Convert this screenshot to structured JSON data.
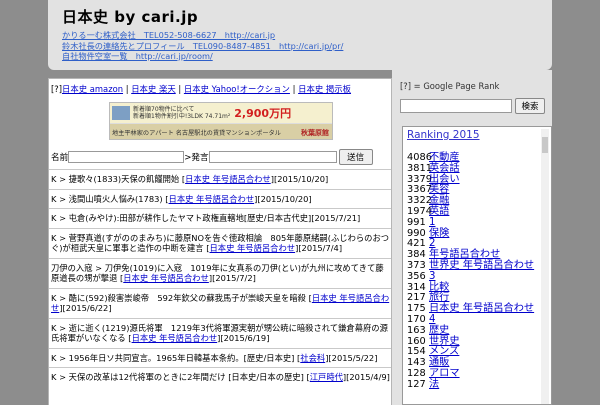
{
  "header": {
    "title": "日本史 by cari.jp",
    "links": [
      "かりる一む株式会社　TEL052-508-6627　http://cari.jp",
      "鈴木社長の連絡先とプロフィール　TEL090-8487-4851　http://cari.jp/pr/",
      "自社物件空室一覧　http://cari.jp/room/"
    ]
  },
  "main": {
    "toplinks": [
      "[?]",
      "日本史 amazon",
      "日本史 楽天",
      "日本史 Yahoo!オークション",
      "日本史 掲示板"
    ],
    "banner": {
      "line1": "新着順70物件に比べて",
      "line1b": "新着順1物件割引中!3LDK 74.71m²",
      "price": "2,900万円",
      "bottom_left": "地主平林家のアパート",
      "bottom_mid": "名古屋駅北の賃貸マンションポータル",
      "bottom_right": "秋葉原館"
    },
    "form": {
      "name_label": "名前",
      "speech_label": ">発言",
      "submit": "送信"
    },
    "entries": [
      {
        "text": "K > 捷歌々(1833)天保の飢饉開始 [",
        "link": "日本史 年号語呂合わせ",
        "tail": "][2015/10/20]"
      },
      {
        "text": "K > 浅間山噴火人悩み(1783) [",
        "link": "日本史 年号語呂合わせ",
        "tail": "][2015/10/20]"
      },
      {
        "text": "K > 屯倉(みやけ):田部が耕作したヤマト政権直轄地[歴史/日本古代史][2015/7/21]",
        "link": "",
        "tail": ""
      },
      {
        "text": "K > 菅野真道(すがののまみち)に藤原NOを告ぐ徳政相論　805年藤原緒嗣(ふじわらのおつぐ)が桓武天皇に軍事と造作の中断を建言 [",
        "link": "日本史 年号語呂合わせ",
        "tail": "][2015/7/4]"
      },
      {
        "text": "刀伊の入寇 > 刀伊免(1019)に入寇　1019年に女真系の刀伊(とい)が九州に攻めてきて藤原道長の甥が撃退 [",
        "link": "日本史 年号語呂合わせ",
        "tail": "][2015/7/2]"
      },
      {
        "text": "K > 酷に(592)殺害崇峻帝　592年欽父の蘇我馬子が崇峻天皇を暗殺 [",
        "link": "日本史 年号語呂合わせ",
        "tail": "][2015/6/22]"
      },
      {
        "text": "K > 逝に逝く(1219)源氏将軍　1219年3代将軍源実朝が甥公暁に暗殺されて鎌倉幕府の源氏将軍がいなくなる [",
        "link": "日本史 年号語呂合わせ",
        "tail": "][2015/6/19]"
      },
      {
        "text": "K > 1956年日ソ共同宣言。1965年日韓基本条約。[歴史/日本史] [",
        "link": "社会科",
        "tail": "][2015/5/22]"
      },
      {
        "text": "K > 天保の改革は12代将軍のときに2年間だけ [日本史/日本の歴史] [",
        "link": "江戸時代",
        "tail": "][2015/4/9]"
      }
    ]
  },
  "sidebar": {
    "gpr": "[?] = Google Page Rank",
    "search_button": "検索",
    "ranking_title": "Ranking 2015",
    "ranking": [
      {
        "n": "4086",
        "label": "不動産"
      },
      {
        "n": "3811",
        "label": "英会話"
      },
      {
        "n": "3379",
        "label": "出会い"
      },
      {
        "n": "3367",
        "label": "美容"
      },
      {
        "n": "3322",
        "label": "金融"
      },
      {
        "n": "1974",
        "label": "英語"
      },
      {
        "n": "991",
        "label": "1"
      },
      {
        "n": "990",
        "label": "保険"
      },
      {
        "n": "421",
        "label": "2"
      },
      {
        "n": "384",
        "label": "年号語呂合わせ"
      },
      {
        "n": "373",
        "label": "世界史 年号語呂合わせ"
      },
      {
        "n": "356",
        "label": "3"
      },
      {
        "n": "314",
        "label": "比較"
      },
      {
        "n": "217",
        "label": "旅行"
      },
      {
        "n": "175",
        "label": "日本史 年号語呂合わせ"
      },
      {
        "n": "170",
        "label": "4"
      },
      {
        "n": "163",
        "label": "歴史"
      },
      {
        "n": "160",
        "label": "世界史"
      },
      {
        "n": "154",
        "label": "メンズ"
      },
      {
        "n": "143",
        "label": "通販"
      },
      {
        "n": "128",
        "label": "アロマ"
      },
      {
        "n": "127",
        "label": "法"
      }
    ]
  }
}
